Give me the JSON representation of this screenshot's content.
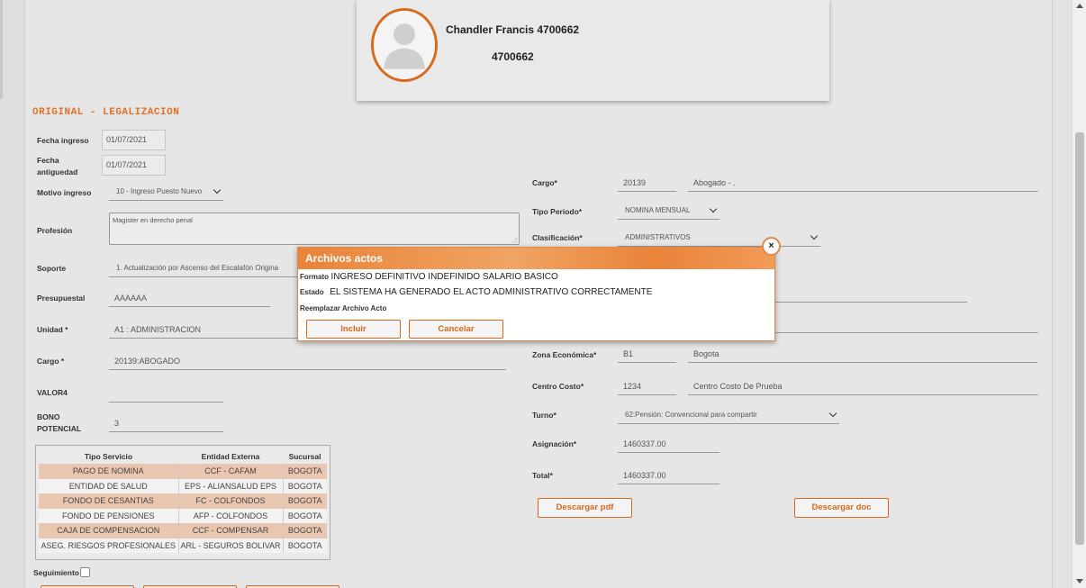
{
  "profile": {
    "name": "Chandler Francis 4700662",
    "id": "4700662"
  },
  "section_title": "ORIGINAL - LEGALIZACION",
  "left_form": {
    "fecha_ingreso_label": "Fecha ingreso",
    "fecha_ingreso": "01/07/2021",
    "fecha_antiguedad_label_1": "Fecha",
    "fecha_antiguedad_label_2": "antiguedad",
    "fecha_antiguedad": "01/07/2021",
    "motivo_label": "Motivo ingreso",
    "motivo": "10 - Ingreso Puesto Nuevo",
    "profesion_label": "Profesión",
    "profesion": "Magister en derecho penal",
    "soporte_label": "Soporte",
    "soporte": "1. Actualización por Ascenso del Escalafón Origina",
    "presupuestal_label": "Presupuestal",
    "presupuestal": "AAAAAA",
    "unidad_label": "Unidad *",
    "unidad": "A1 : ADMINISTRACION",
    "cargo_label": "Cargo *",
    "cargo": "20139:ABOGADO",
    "valor4_label": "VALOR4",
    "valor4": "",
    "bono_label_1": "BONO",
    "bono_label_2": "POTENCIAL",
    "bono": "3",
    "seguimiento_label": "Seguimiento"
  },
  "services_table": {
    "headers": [
      "Tipo Servicio",
      "Entidad Externa",
      "Sucursal"
    ],
    "rows": [
      [
        "PAGO DE NOMINA",
        "CCF - CAFAM",
        "BOGOTA"
      ],
      [
        "ENTIDAD DE SALUD",
        "EPS - ALIANSALUD EPS",
        "BOGOTA"
      ],
      [
        "FONDO DE CESANTIAS",
        "FC - COLFONDOS",
        "BOGOTA"
      ],
      [
        "FONDO DE PENSIONES",
        "AFP - COLFONDOS",
        "BOGOTA"
      ],
      [
        "CAJA DE COMPENSACION",
        "CCF - COMPENSAR",
        "BOGOTA"
      ],
      [
        "ASEG. RIESGOS PROFESIONALES",
        "ARL - SEGUROS BOLIVAR",
        "BOGOTA"
      ]
    ]
  },
  "right_form": {
    "cargo_label": "Cargo*",
    "cargo_code": "20139",
    "cargo_name": "Abogado - .",
    "tipo_periodo_label": "Tipo Periodo*",
    "tipo_periodo": "NOMINA MENSUAL",
    "clasificacion_label": "Clasificación*",
    "clasificacion": "ADMINISTRATIVOS",
    "zona_label": "Zona Económica*",
    "zona_code": "B1",
    "zona_name": "Bogota",
    "centro_label": "Centro Costo*",
    "centro_code": "1234",
    "centro_name": "Centro Costo De Prueba",
    "turno_label": "Turno*",
    "turno": "62:Pensión: Convencional para compartir",
    "asignacion_label": "Asignación*",
    "asignacion": "1460337.00",
    "total_label": "Total*",
    "total": "1460337.00",
    "download_pdf": "Descargar pdf",
    "download_doc": "Descargar doc"
  },
  "modal": {
    "title": "Archivos actos",
    "close_symbol": "×",
    "formato_label": "Formato",
    "formato": "INGRESO DEFINITIVO INDEFINIDO SALARIO BASICO",
    "estado_label": "Estado",
    "estado": "EL SISTEMA HA GENERADO EL ACTO ADMINISTRATIVO CORRECTAMENTE",
    "reemplazar_label": "Reemplazar Archivo Acto",
    "incluir": "Incluir",
    "cancelar": "Cancelar"
  },
  "colors": {
    "accent": "#d2691e",
    "row_highlight": "#e9c6b0"
  }
}
